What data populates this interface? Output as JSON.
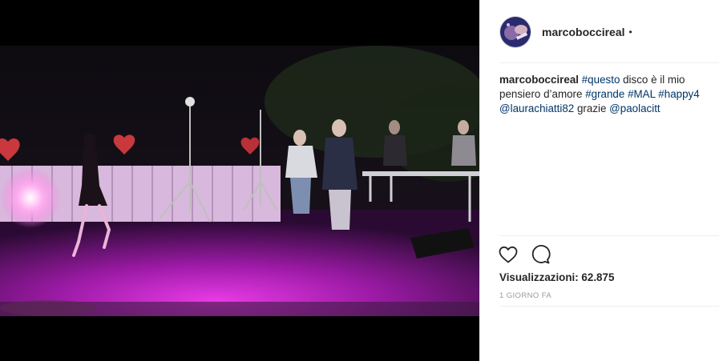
{
  "post": {
    "username": "marcoboccireal",
    "follow_dot": "•",
    "caption": {
      "author": "marcoboccireal",
      "tag1": "#questo",
      "t1": " disco è il mio pensiero d’amore ",
      "tag2": "#grande",
      "tag3": "#MAL",
      "tag4": "#happy4",
      "mention1": "@laurachiatti82",
      "t2": " grazie ",
      "mention2": "@paolacitt"
    },
    "views_label": "Visualizzazioni: 62.875",
    "time_ago": "1 GIORNO FA"
  },
  "icons": {
    "like": "heart-icon",
    "comment": "comment-icon"
  },
  "colors": {
    "link": "#003569",
    "text": "#262626",
    "muted": "#999999",
    "stage_light": "#d52ad8"
  }
}
